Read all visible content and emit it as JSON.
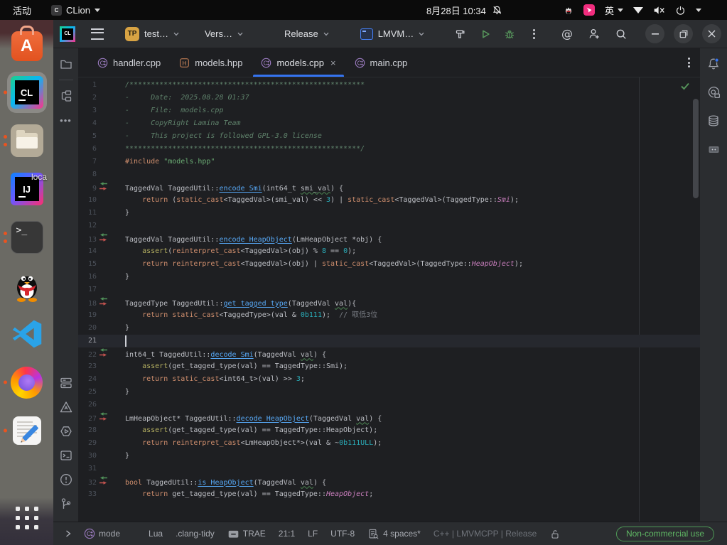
{
  "system_bar": {
    "activities_label": "活动",
    "app_name": "CLion",
    "clock": "8月28日 10:34",
    "input_indicator": "英",
    "tray_icon_names": [
      "qq-tray-icon",
      "pink-app-tray-icon",
      "input-method",
      "wifi-icon",
      "volume-muted-icon",
      "power-icon"
    ]
  },
  "dock": {
    "desktop_label_fragment": "loca",
    "apps": [
      {
        "id": "ubuntu-software",
        "running": false
      },
      {
        "id": "clion",
        "running": true,
        "active": true,
        "dots": 1
      },
      {
        "id": "files",
        "running": true,
        "dots": 2
      },
      {
        "id": "intellij-idea",
        "running": false
      },
      {
        "id": "terminal",
        "running": true,
        "dots": 2
      },
      {
        "id": "qq",
        "running": false
      },
      {
        "id": "vscode",
        "running": false
      },
      {
        "id": "firefox",
        "running": true,
        "dots": 1
      },
      {
        "id": "text-editor",
        "running": true,
        "dots": 1
      },
      {
        "id": "show-applications",
        "running": false
      }
    ]
  },
  "ide": {
    "titlebar": {
      "project_button": "test…",
      "project_avatar": "TP",
      "vcs_button": "Vers…",
      "build_type_button": "Release",
      "run_config_button": "LMVM…"
    },
    "tab_bar": {
      "tabs": [
        {
          "label": "handler.cpp",
          "icon": "cpp",
          "active": false,
          "closable": false
        },
        {
          "label": "models.hpp",
          "icon": "hpp",
          "active": false,
          "closable": false
        },
        {
          "label": "models.cpp",
          "icon": "cpp",
          "active": true,
          "closable": true
        },
        {
          "label": "main.cpp",
          "icon": "cpp",
          "active": false,
          "closable": false
        }
      ]
    },
    "editor": {
      "current_line": 21,
      "lines": [
        {
          "n": 1,
          "g": 0,
          "s": [
            [
              "/*******************************************************",
              "c"
            ]
          ]
        },
        {
          "n": 2,
          "g": 0,
          "s": [
            [
              "-     Date:  2025.08.28 01:37",
              "c"
            ]
          ]
        },
        {
          "n": 3,
          "g": 0,
          "s": [
            [
              "-     File:  models.cpp",
              "c"
            ]
          ]
        },
        {
          "n": 4,
          "g": 0,
          "s": [
            [
              "-     CopyRight Lamina Team",
              "c"
            ]
          ]
        },
        {
          "n": 5,
          "g": 0,
          "s": [
            [
              "-     This project is followed GPL-3.0 license",
              "c"
            ]
          ]
        },
        {
          "n": 6,
          "g": 0,
          "s": [
            [
              "*******************************************************/",
              "c"
            ]
          ]
        },
        {
          "n": 7,
          "g": 0,
          "s": [
            [
              "#include",
              "k"
            ],
            [
              " ",
              "d"
            ],
            [
              "\"models.hpp\"",
              "s"
            ]
          ]
        },
        {
          "n": 8,
          "g": 0,
          "s": []
        },
        {
          "n": 9,
          "g": 1,
          "s": [
            [
              "TaggedVal TaggedUtil::",
              "d"
            ],
            [
              "encode_Smi",
              "f"
            ],
            [
              "(int64_t ",
              "d"
            ],
            [
              "smi_val",
              "w"
            ],
            [
              ") {",
              "d"
            ]
          ]
        },
        {
          "n": 10,
          "g": 0,
          "s": [
            [
              "    ",
              "d"
            ],
            [
              "return",
              "k"
            ],
            [
              " (",
              "d"
            ],
            [
              "static_cast",
              "k"
            ],
            [
              "<TaggedVal>(smi_val) << ",
              "d"
            ],
            [
              "3",
              "n"
            ],
            [
              ") | ",
              "d"
            ],
            [
              "static_cast",
              "k"
            ],
            [
              "<TaggedVal>(TaggedType::",
              "d"
            ],
            [
              "Smi",
              "e"
            ],
            [
              ");",
              "d"
            ]
          ]
        },
        {
          "n": 11,
          "g": 0,
          "s": [
            [
              "}",
              "d"
            ]
          ]
        },
        {
          "n": 12,
          "g": 0,
          "s": []
        },
        {
          "n": 13,
          "g": 1,
          "s": [
            [
              "TaggedVal TaggedUtil::",
              "d"
            ],
            [
              "encode_HeapObject",
              "f"
            ],
            [
              "(LmHeapObject *obj) {",
              "d"
            ]
          ]
        },
        {
          "n": 14,
          "g": 0,
          "s": [
            [
              "    ",
              "d"
            ],
            [
              "assert",
              "m"
            ],
            [
              "(",
              "d"
            ],
            [
              "reinterpret_cast",
              "k"
            ],
            [
              "<TaggedVal>(obj) % ",
              "d"
            ],
            [
              "8",
              "n"
            ],
            [
              " == ",
              "d"
            ],
            [
              "0",
              "n"
            ],
            [
              ");",
              "d"
            ]
          ]
        },
        {
          "n": 15,
          "g": 0,
          "s": [
            [
              "    ",
              "d"
            ],
            [
              "return",
              "k"
            ],
            [
              " ",
              "d"
            ],
            [
              "reinterpret_cast",
              "k"
            ],
            [
              "<TaggedVal>(obj) | ",
              "d"
            ],
            [
              "static_cast",
              "k"
            ],
            [
              "<TaggedVal>(TaggedType::",
              "d"
            ],
            [
              "HeapObject",
              "e"
            ],
            [
              ");",
              "d"
            ]
          ]
        },
        {
          "n": 16,
          "g": 0,
          "s": [
            [
              "}",
              "d"
            ]
          ]
        },
        {
          "n": 17,
          "g": 0,
          "s": []
        },
        {
          "n": 18,
          "g": 1,
          "s": [
            [
              "TaggedType TaggedUtil::",
              "d"
            ],
            [
              "get_tagged_type",
              "f"
            ],
            [
              "(TaggedVal ",
              "d"
            ],
            [
              "val",
              "w"
            ],
            [
              "){",
              "d"
            ]
          ]
        },
        {
          "n": 19,
          "g": 0,
          "s": [
            [
              "    ",
              "d"
            ],
            [
              "return",
              "k"
            ],
            [
              " ",
              "d"
            ],
            [
              "static_cast",
              "k"
            ],
            [
              "<TaggedType>(val & ",
              "d"
            ],
            [
              "0b111",
              "n"
            ],
            [
              ");  ",
              "d"
            ],
            [
              "// 取低3位",
              "lc"
            ]
          ]
        },
        {
          "n": 20,
          "g": 0,
          "s": [
            [
              "}",
              "d"
            ]
          ]
        },
        {
          "n": 21,
          "g": 0,
          "s": []
        },
        {
          "n": 22,
          "g": 1,
          "s": [
            [
              "int64_t TaggedUtil::",
              "d"
            ],
            [
              "decode_Smi",
              "f"
            ],
            [
              "(TaggedVal ",
              "d"
            ],
            [
              "val",
              "w"
            ],
            [
              ") {",
              "d"
            ]
          ]
        },
        {
          "n": 23,
          "g": 0,
          "s": [
            [
              "    ",
              "d"
            ],
            [
              "assert",
              "m"
            ],
            [
              "(get_tagged_type(val) == TaggedType::Smi);",
              "d"
            ]
          ]
        },
        {
          "n": 24,
          "g": 0,
          "s": [
            [
              "    ",
              "d"
            ],
            [
              "return",
              "k"
            ],
            [
              " ",
              "d"
            ],
            [
              "static_cast",
              "k"
            ],
            [
              "<int64_t>(val) >> ",
              "d"
            ],
            [
              "3",
              "n"
            ],
            [
              ";",
              "d"
            ]
          ]
        },
        {
          "n": 25,
          "g": 0,
          "s": [
            [
              "}",
              "d"
            ]
          ]
        },
        {
          "n": 26,
          "g": 0,
          "s": []
        },
        {
          "n": 27,
          "g": 1,
          "s": [
            [
              "LmHeapObject* TaggedUtil::",
              "d"
            ],
            [
              "decode_HeapObject",
              "f"
            ],
            [
              "(TaggedVal ",
              "d"
            ],
            [
              "val",
              "w"
            ],
            [
              ") {",
              "d"
            ]
          ]
        },
        {
          "n": 28,
          "g": 0,
          "s": [
            [
              "    ",
              "d"
            ],
            [
              "assert",
              "m"
            ],
            [
              "(get_tagged_type(val) == TaggedType::HeapObject);",
              "d"
            ]
          ]
        },
        {
          "n": 29,
          "g": 0,
          "s": [
            [
              "    ",
              "d"
            ],
            [
              "return",
              "k"
            ],
            [
              " ",
              "d"
            ],
            [
              "reinterpret_cast",
              "k"
            ],
            [
              "<LmHeapObject*>(val & ~",
              "d"
            ],
            [
              "0b111ULL",
              "n"
            ],
            [
              ");",
              "d"
            ]
          ]
        },
        {
          "n": 30,
          "g": 0,
          "s": [
            [
              "}",
              "d"
            ]
          ]
        },
        {
          "n": 31,
          "g": 0,
          "s": []
        },
        {
          "n": 32,
          "g": 1,
          "s": [
            [
              "bool",
              "k"
            ],
            [
              " TaggedUtil::",
              "d"
            ],
            [
              "is_HeapObject",
              "f"
            ],
            [
              "(TaggedVal ",
              "d"
            ],
            [
              "val",
              "w"
            ],
            [
              ") {",
              "d"
            ]
          ]
        },
        {
          "n": 33,
          "g": 0,
          "s": [
            [
              "    ",
              "d"
            ],
            [
              "return",
              "k"
            ],
            [
              " get_tagged_type(val) == TaggedType::",
              "d"
            ],
            [
              "HeapObject",
              "e"
            ],
            [
              ";",
              "d"
            ]
          ]
        }
      ]
    },
    "status_bar": {
      "mode_label": "mode",
      "lua_label": "Lua",
      "clang_tidy_label": ".clang-tidy",
      "trae_label": "TRAE",
      "caret_position": "21:1",
      "line_separator": "LF",
      "encoding": "UTF-8",
      "indent_label": "4 spaces*",
      "build_context": "C++ | LMVMCPP | Release",
      "license_badge": "Non-commercial use"
    }
  }
}
